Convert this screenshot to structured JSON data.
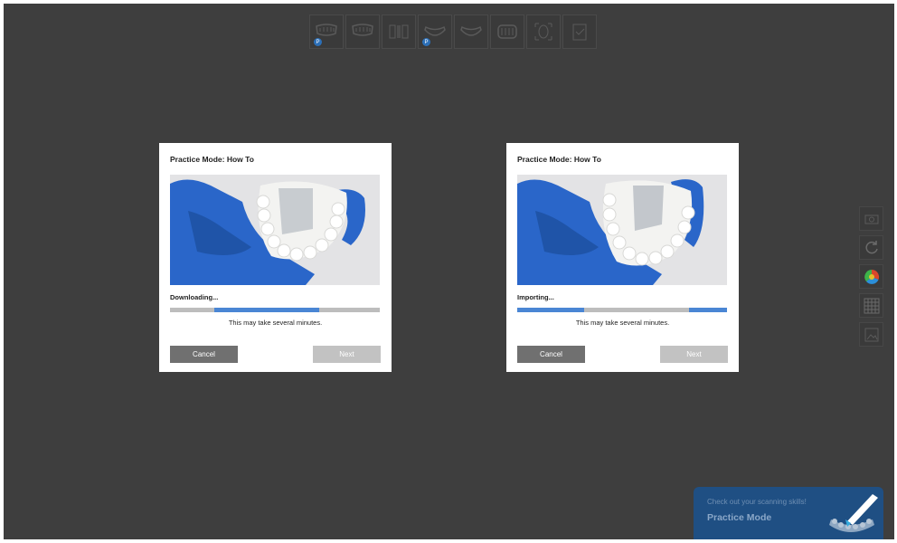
{
  "toolbar": {
    "tools": [
      {
        "icon": "upper-jaw-icon",
        "badge": "P"
      },
      {
        "icon": "upper-jaw-icon",
        "badge": ""
      },
      {
        "icon": "bite-icon",
        "badge": ""
      },
      {
        "icon": "lower-jaw-icon",
        "badge": "P"
      },
      {
        "icon": "lower-jaw-icon",
        "badge": ""
      },
      {
        "icon": "full-arch-icon",
        "badge": ""
      },
      {
        "icon": "face-scan-icon",
        "badge": ""
      },
      {
        "icon": "checklist-icon",
        "badge": ""
      }
    ]
  },
  "dialogs": [
    {
      "title": "Practice Mode: How To",
      "status": "Downloading...",
      "note": "This may take several minutes.",
      "cancel_label": "Cancel",
      "next_label": "Next",
      "progress": {
        "segments": [
          [
            0.21,
            0.71
          ]
        ]
      }
    },
    {
      "title": "Practice Mode: How To",
      "status": "Importing...",
      "note": "This may take several minutes.",
      "cancel_label": "Cancel",
      "next_label": "Next",
      "progress": {
        "segments": [
          [
            0,
            0.32
          ],
          [
            0.82,
            1
          ]
        ]
      }
    }
  ],
  "side_tools": [
    "camera-icon",
    "refresh-icon",
    "color-wheel-icon",
    "grid-icon",
    "image-icon"
  ],
  "promo": {
    "subtitle": "Check out your scanning skills!",
    "title": "Practice Mode"
  },
  "colors": {
    "accent": "#4a86d4",
    "background": "#3e3e3e",
    "promo": "#1f4f83"
  }
}
